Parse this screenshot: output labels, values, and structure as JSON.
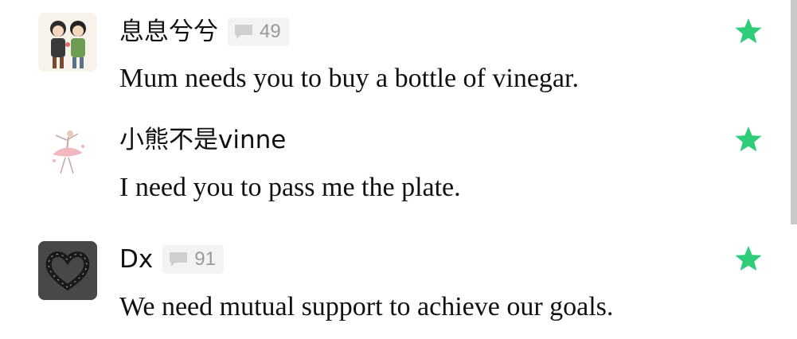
{
  "accent_color": "#2fcc7a",
  "comments": [
    {
      "username": "息息兮兮",
      "avatar": "couple-illustration-avatar",
      "comment_count": "49",
      "message": "Mum needs you to buy a bottle of vinegar.",
      "star_icon": "star-icon"
    },
    {
      "username": "小熊不是vinne",
      "avatar": "ballerina-sketch-avatar",
      "message": "I need you to pass me the plate.",
      "star_icon": "star-icon"
    },
    {
      "username": "Dx",
      "avatar": "heart-stones-avatar",
      "comment_count": "91",
      "message": "We need mutual support to achieve our goals.",
      "star_icon": "star-icon"
    }
  ]
}
